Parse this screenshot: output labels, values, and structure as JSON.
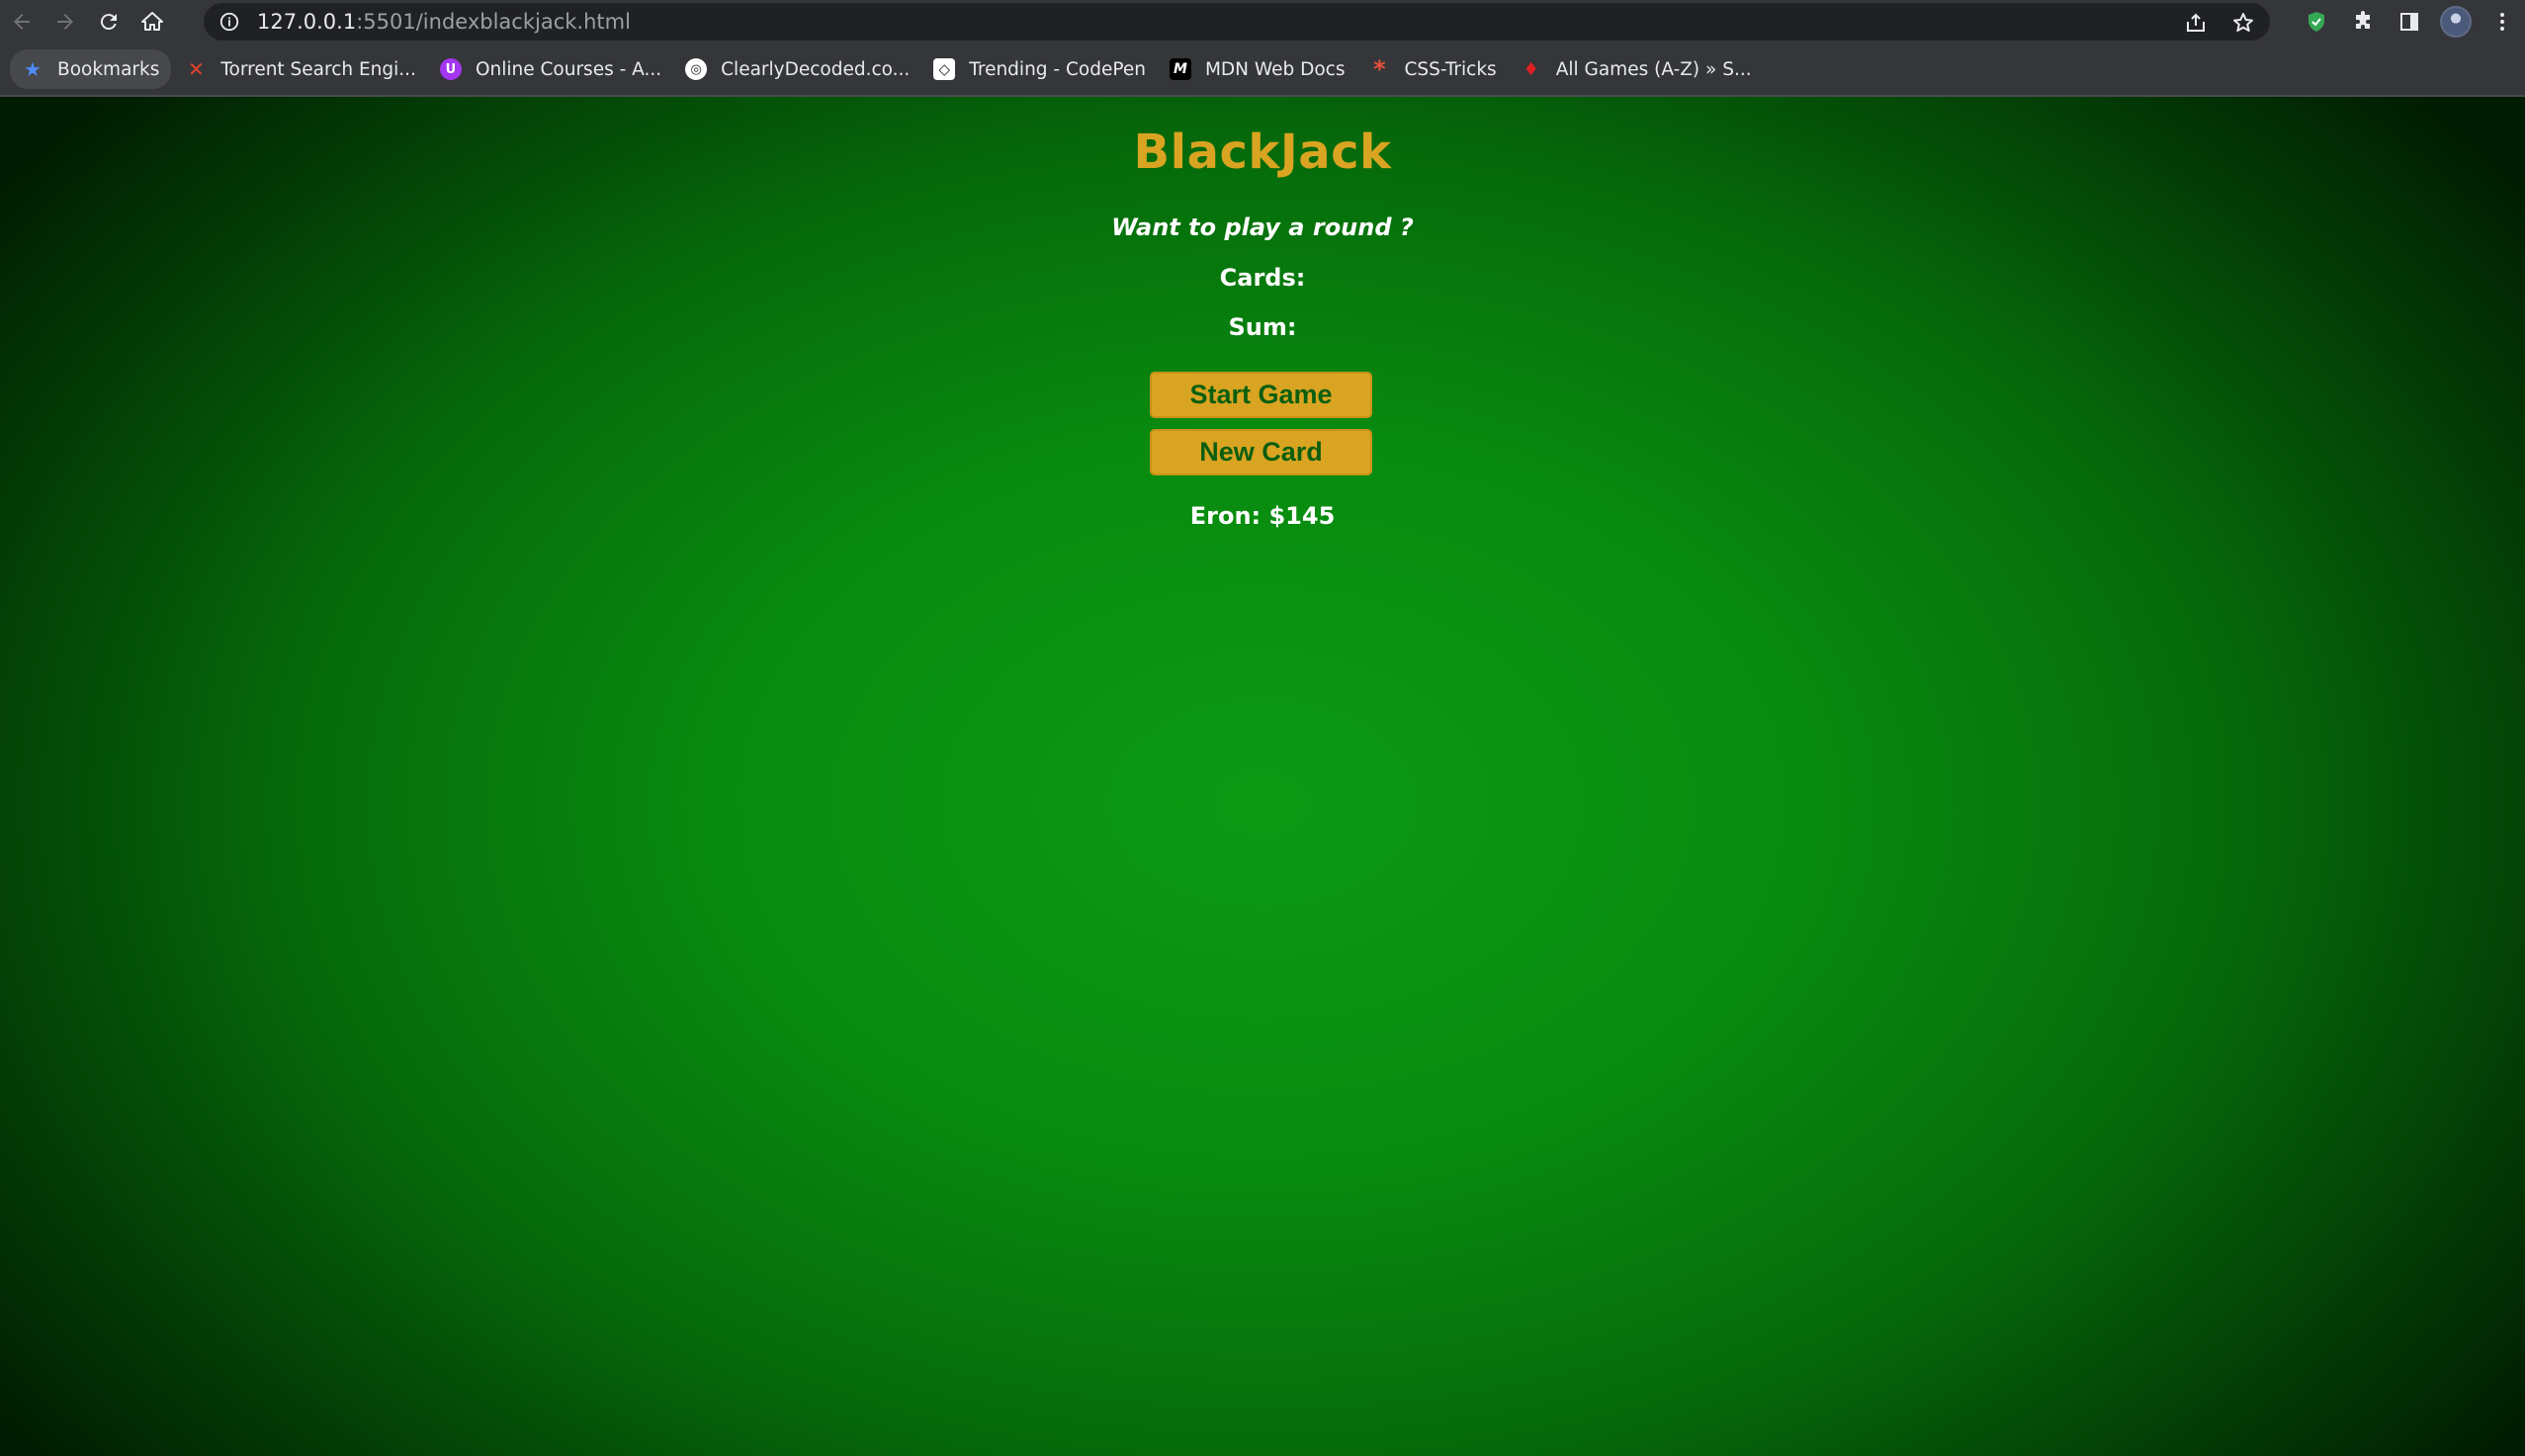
{
  "browser": {
    "url_host": "127.0.0.1",
    "url_path": ":5501/indexblackjack.html",
    "bookmarks": [
      {
        "label": "Bookmarks",
        "icon": "star-icon",
        "color": "#4c8bf5"
      },
      {
        "label": "Torrent Search Engi...",
        "icon": "x-icon",
        "color": "#e0432b"
      },
      {
        "label": "Online Courses - A...",
        "icon": "udemy-icon",
        "color": "#a435f0"
      },
      {
        "label": "ClearlyDecoded.co...",
        "icon": "globe-icon",
        "color": "#ffffff"
      },
      {
        "label": "Trending - CodePen",
        "icon": "codepen-icon",
        "color": "#ffffff"
      },
      {
        "label": "MDN Web Docs",
        "icon": "mdn-icon",
        "color": "#ffffff"
      },
      {
        "label": "CSS-Tricks",
        "icon": "asterisk-icon",
        "color": "#e8503a"
      },
      {
        "label": "All Games (A-Z) » S...",
        "icon": "game-icon",
        "color": "#e02020"
      }
    ]
  },
  "game": {
    "title": "BlackJack",
    "prompt": "Want to play a round ?",
    "cards_label": "Cards:",
    "sum_label": "Sum:",
    "start_button": "Start Game",
    "new_card_button": "New Card",
    "player": "Eron: $145"
  },
  "colors": {
    "accent_gold": "#d9a421",
    "button_text_green": "#0b5e10",
    "felt_green": "#088a0f"
  }
}
